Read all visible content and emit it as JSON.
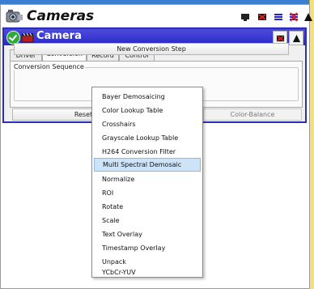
{
  "app": {
    "title": "Cameras"
  },
  "camera": {
    "title": "Camera",
    "tabs": [
      {
        "label": "Driver"
      },
      {
        "label": "Conversion"
      },
      {
        "label": "Record"
      },
      {
        "label": "Control"
      }
    ],
    "group_label": "Conversion Sequence",
    "new_step_label": "New Conversion Step",
    "reset_label": "Reset",
    "color_balance_label": "Color-Balance"
  },
  "menu": {
    "items": [
      "Bayer Demosaicing",
      "Color Lookup Table",
      "Crosshairs",
      "Grayscale Lookup Table",
      "H264 Conversion Filter",
      "Multi Spectral Demosaic",
      "Normalize",
      "ROI",
      "Rotate",
      "Scale",
      "Text Overlay",
      "Timestamp Overlay",
      "Unpack",
      "YCbCr-YUV"
    ],
    "selected": "Multi Spectral Demosaic"
  },
  "colors": {
    "accent": "#2b2fb8",
    "menu_highlight": "#cde3f7",
    "side_bar": "#f4e07a"
  },
  "icons": [
    "cameras-app-icon",
    "minimize-icon",
    "close-icon",
    "list-icon",
    "x-icon",
    "collapse-triangle-icon",
    "check-icon",
    "clapperboard-icon"
  ]
}
